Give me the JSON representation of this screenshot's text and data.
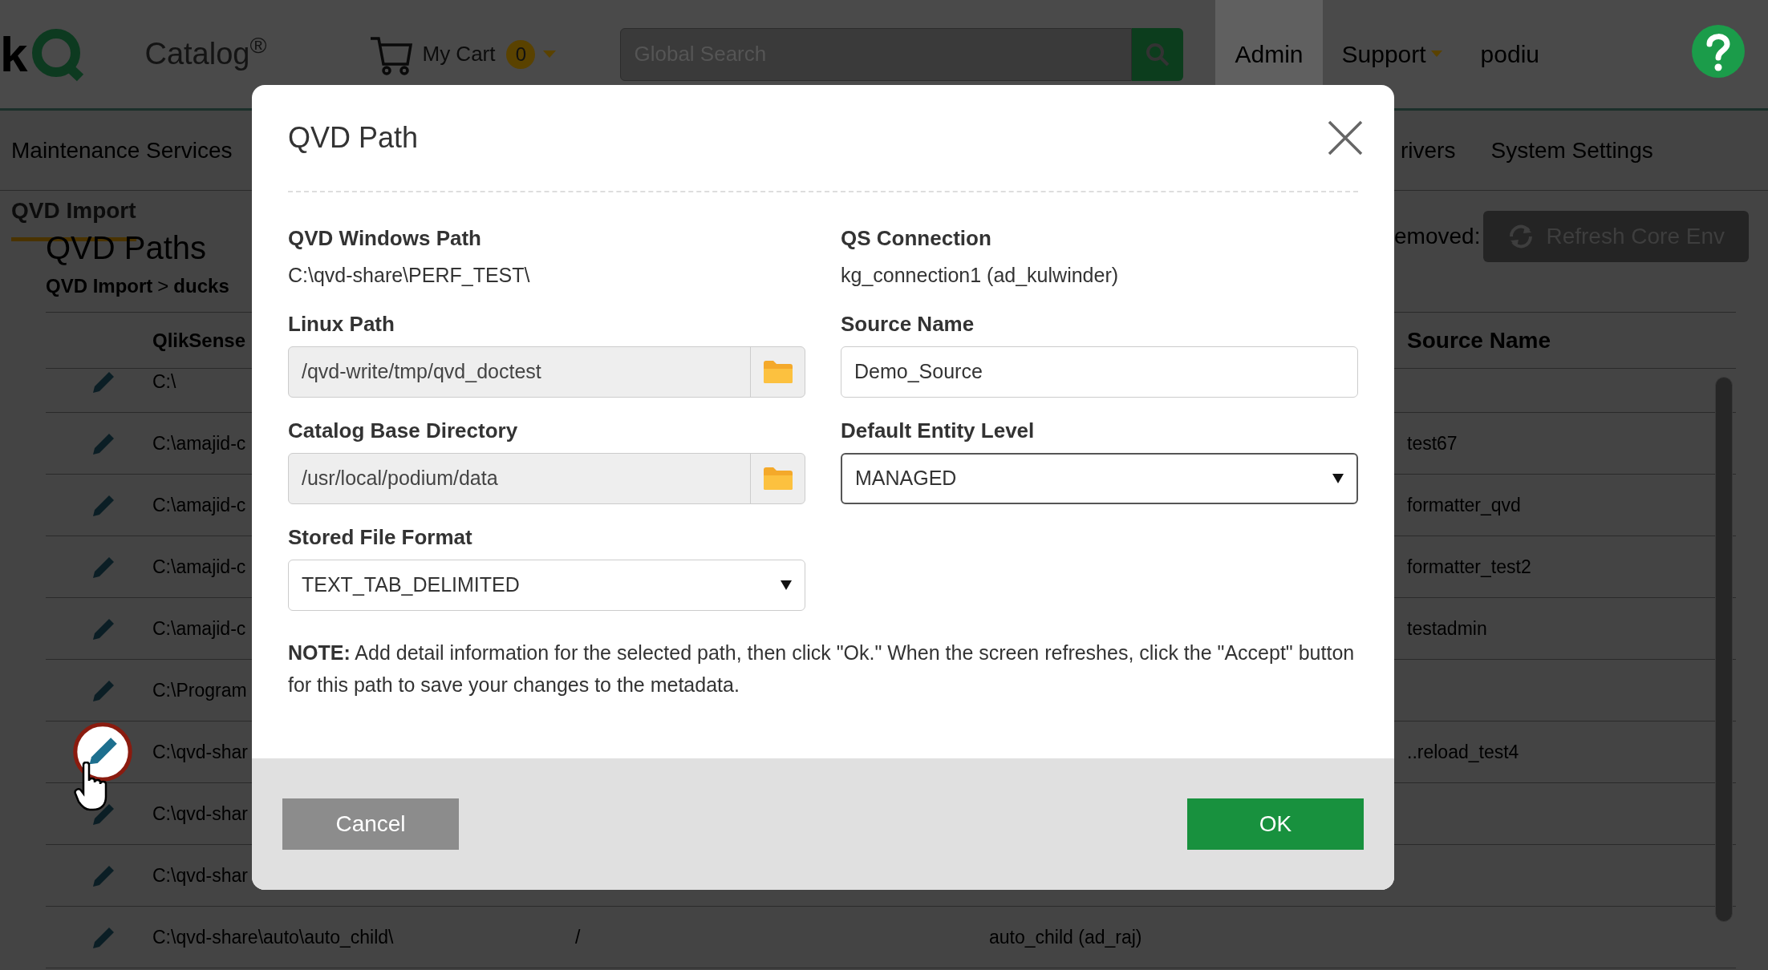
{
  "header": {
    "logo_letter": "k",
    "product": "Catalog$^{®}$",
    "cart": {
      "label": "My Cart",
      "count": "0"
    },
    "search": {
      "placeholder": "Global Search"
    },
    "nav": [
      {
        "label": "Admin",
        "selected": true,
        "dropdown": false
      },
      {
        "label": "Support",
        "selected": false,
        "dropdown": true
      },
      {
        "label": "podiu",
        "selected": false,
        "dropdown": false
      }
    ]
  },
  "tabs": [
    {
      "label": "Maintenance Services"
    },
    {
      "label": "rivers"
    },
    {
      "label": "System Settings"
    }
  ],
  "subtabs": [
    {
      "label": "QVD Import",
      "selected": true
    }
  ],
  "page": {
    "title": "QVD Paths",
    "breadcrumb": [
      "QVD Import",
      "ducks"
    ],
    "separator": ">",
    "removed_label": "emoved:",
    "refresh_button": "Refresh Core Env"
  },
  "table": {
    "columns": [
      "QlikSense",
      "Source Name"
    ],
    "rows": [
      {
        "path": "C:\\",
        "source": "",
        "hovered": false
      },
      {
        "path": "C:\\amajid-c",
        "source": "test67",
        "hovered": false
      },
      {
        "path": "C:\\amajid-c",
        "source": "formatter_qvd",
        "hovered": false
      },
      {
        "path": "C:\\amajid-c",
        "source": "formatter_test2",
        "hovered": false
      },
      {
        "path": "C:\\amajid-c",
        "source": "testadmin",
        "hovered": false
      },
      {
        "path": "C:\\Program",
        "source": "",
        "hovered": false
      },
      {
        "path": "C:\\qvd-shar",
        "source": "..reload_test4",
        "hovered": true
      },
      {
        "path": "C:\\qvd-shar",
        "source": "",
        "hovered": false
      },
      {
        "path": "C:\\qvd-shar",
        "source": "",
        "hovered": false
      },
      {
        "path": "C:\\qvd-share\\auto\\auto_child\\",
        "column_2": "/",
        "column_3": "auto_child (ad_raj)",
        "source": "",
        "hovered": false
      }
    ]
  },
  "dialog": {
    "title": "QVD Path",
    "left": [
      {
        "kind": "text",
        "label": "QVD Windows Path",
        "value": "C:\\qvd-share\\PERF_TEST\\"
      },
      {
        "kind": "browse",
        "label": "Linux Path",
        "value": "/qvd-write/tmp/qvd_doctest"
      },
      {
        "kind": "browse",
        "label": "Catalog Base Directory",
        "value": "/usr/local/podium/data"
      },
      {
        "kind": "select",
        "label": "Stored File Format",
        "value": "TEXT_TAB_DELIMITED"
      }
    ],
    "right": [
      {
        "kind": "text",
        "label": "QS Connection",
        "value": "kg_connection1 (ad_kulwinder)"
      },
      {
        "kind": "input",
        "label": "Source Name",
        "value": "Demo_Source"
      },
      {
        "kind": "select",
        "label": "Default Entity Level",
        "value": "MANAGED"
      }
    ],
    "note": "**NOTE:** Add detail information for the selected path, then click \"Ok.\" When the screen refreshes, click the \"Accept\" button for this path to save your changes to the metadata.",
    "buttons": [
      {
        "kind": "cancel",
        "label": "Cancel"
      },
      {
        "kind": "ok",
        "label": "OK"
      }
    ]
  }
}
